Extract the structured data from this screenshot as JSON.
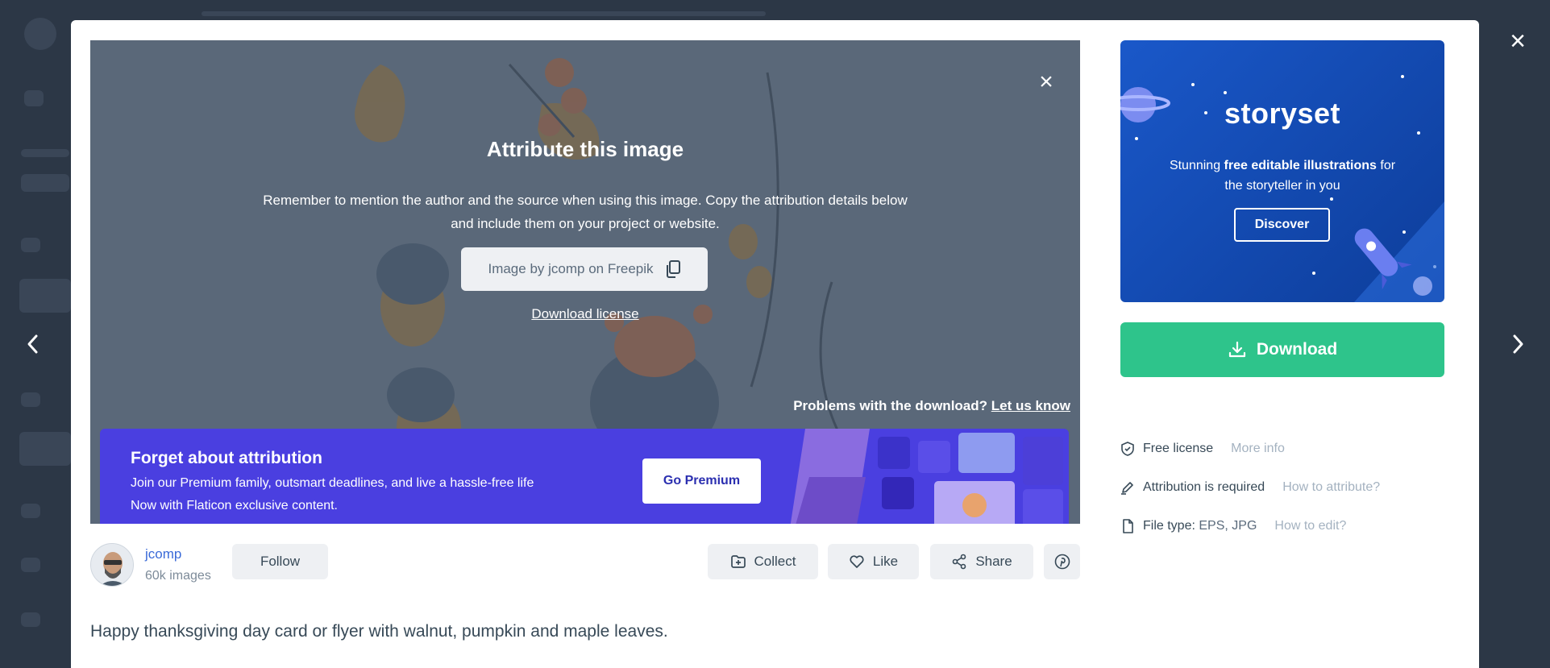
{
  "attribution": {
    "title": "Attribute this image",
    "desc_line1": "Remember to mention the author and the source when using this image. Copy the attribution details below",
    "desc_line2": "and include them on your project or website.",
    "credit": "Image by jcomp on Freepik",
    "download_license": "Download license",
    "problems_text": "Problems with the download?",
    "problems_link": "Let us know"
  },
  "premium": {
    "title": "Forget about attribution",
    "line1": "Join our Premium family, outsmart deadlines, and live a hassle-free life",
    "line2": "Now with Flaticon exclusive content.",
    "button": "Go Premium"
  },
  "author": {
    "name": "jcomp",
    "count": "60k images",
    "follow": "Follow"
  },
  "actions": {
    "collect": "Collect",
    "like": "Like",
    "share": "Share"
  },
  "description": "Happy thanksgiving day card or flyer with walnut, pumpkin and maple leaves.",
  "storyset": {
    "logo": "storyset",
    "text_pre": "Stunning ",
    "text_bold": "free editable illustrations",
    "text_post": " for",
    "text_line2": "the storyteller in you",
    "button": "Discover"
  },
  "download": {
    "label": "Download"
  },
  "meta": {
    "license": "Free license",
    "license_link": "More info",
    "attribution": "Attribution is required",
    "attribution_link": "How to attribute?",
    "filetype_label": "File type:",
    "filetype_value": "EPS, JPG",
    "filetype_link": "How to edit?"
  },
  "colors": {
    "download_green": "#2ec48b",
    "premium_purple": "#4a3fe0",
    "storyset_blue": "#1a58c9",
    "author_link": "#3a6ad8"
  }
}
